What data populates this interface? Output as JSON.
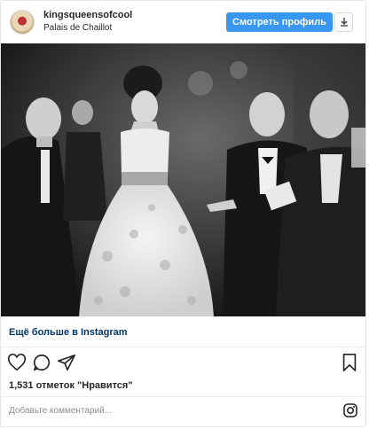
{
  "post": {
    "username": "kingsqueensofcool",
    "location": "Palais de Chaillot",
    "view_profile_label": "Смотреть профиль",
    "more_on_instagram": "Ещё больше в Instagram",
    "likes_text": "1,531 отметок \"Нравится\"",
    "comment_placeholder": "Добавьте комментарий..."
  },
  "icons": {
    "download": "download-icon",
    "like": "heart-icon",
    "comment": "comment-icon",
    "share": "share-icon",
    "save": "bookmark-icon",
    "instagram": "instagram-logo-icon"
  },
  "colors": {
    "accent": "#3897f0",
    "link": "#003569"
  }
}
